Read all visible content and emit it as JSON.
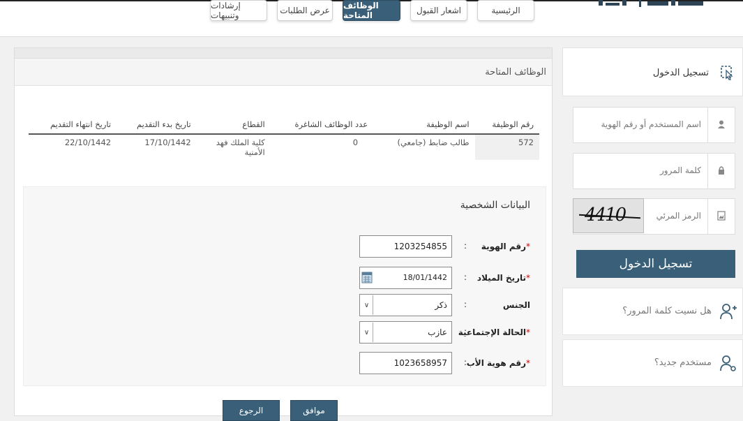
{
  "nav": {
    "items": [
      {
        "label": "الرئيسية",
        "active": false
      },
      {
        "label": "اشعار القبول",
        "active": false
      },
      {
        "label": "الوظائف المتاحة",
        "active": true
      },
      {
        "label": "عرض الطلبات",
        "active": false
      },
      {
        "label": "إرشادات وتنبيهات",
        "active": false
      }
    ]
  },
  "sidebar": {
    "login_title": "تسجيل الدخول",
    "username_placeholder": "اسم المستخدم أو رقم الهوية",
    "password_placeholder": "كلمة المرور",
    "captcha_placeholder": "الرمز المرئي",
    "captcha_text": "4410",
    "login_button": "تسجيل الدخول",
    "forgot_password": "هل نسيت كلمة المرور؟",
    "new_user": "مستخدم جديد؟"
  },
  "main": {
    "title": "الوظائف المتاحة",
    "jobs_table": {
      "headers": [
        "رقم الوظيفة",
        "اسم الوظيفة",
        "عدد الوظائف الشاغرة",
        "القطاع",
        "تاريخ بدء التقديم",
        "تاريخ انتهاء التقديم"
      ],
      "rows": [
        [
          "572",
          "طالب ضابط (جامعي)",
          "0",
          "كلية الملك فهد الأمنية",
          "17/10/1442",
          "22/10/1442"
        ]
      ]
    },
    "personal": {
      "title": "البيانات الشخصية",
      "id_label": "رقم الهوية",
      "id_value": "1203254855",
      "dob_label": "تاريخ الميلاد",
      "dob_value": "18/01/1442",
      "gender_label": "الجنس",
      "gender_value": "ذكر",
      "marital_label": "الحالة الإجتماعية",
      "marital_value": "عازب",
      "father_id_label": "رقم هوية الأب",
      "father_id_value": "1023658957",
      "required_mark": "*",
      "colon": ":"
    },
    "buttons": {
      "ok": "موافق",
      "back": "الرجوع"
    }
  },
  "colors": {
    "accent": "#3a5f78",
    "required": "#cc0000"
  }
}
